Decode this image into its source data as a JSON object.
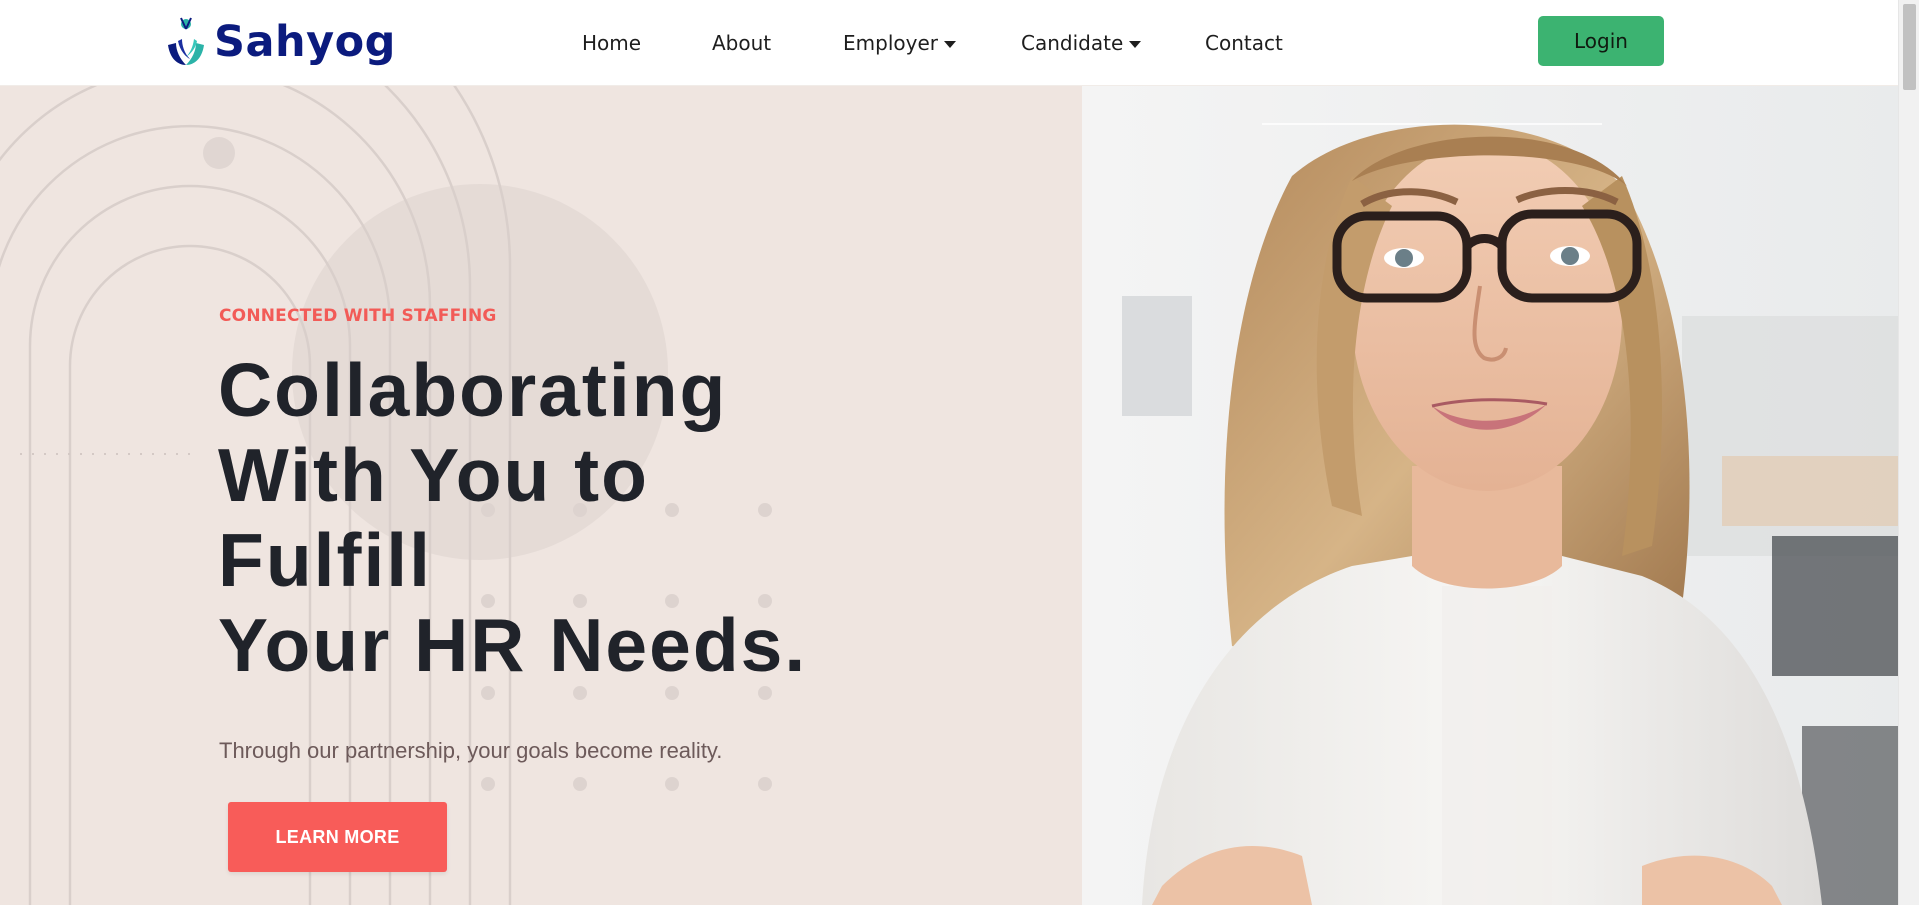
{
  "brand": {
    "name": "Sahyog",
    "logo_icon": "hands-leaf-logo-icon"
  },
  "nav": {
    "home": "Home",
    "about": "About",
    "employer": "Employer",
    "candidate": "Candidate",
    "contact": "Contact",
    "login": "Login"
  },
  "hero": {
    "eyebrow": "CONNECTED WITH STAFFING",
    "headline_lines": [
      "Collaborating",
      "With You to",
      "Fulfill",
      "Your HR Needs."
    ],
    "subtext": "Through our partnership, your goals become reality.",
    "cta": "LEARN MORE",
    "image_alt": "woman-with-glasses-portrait"
  },
  "colors": {
    "brand_blue": "#0b1b7e",
    "login_green": "#3cb371",
    "accent_red": "#f85c59",
    "eyebrow_red": "#f25b57",
    "hero_bg": "#efe5e0",
    "headline": "#20232a"
  }
}
